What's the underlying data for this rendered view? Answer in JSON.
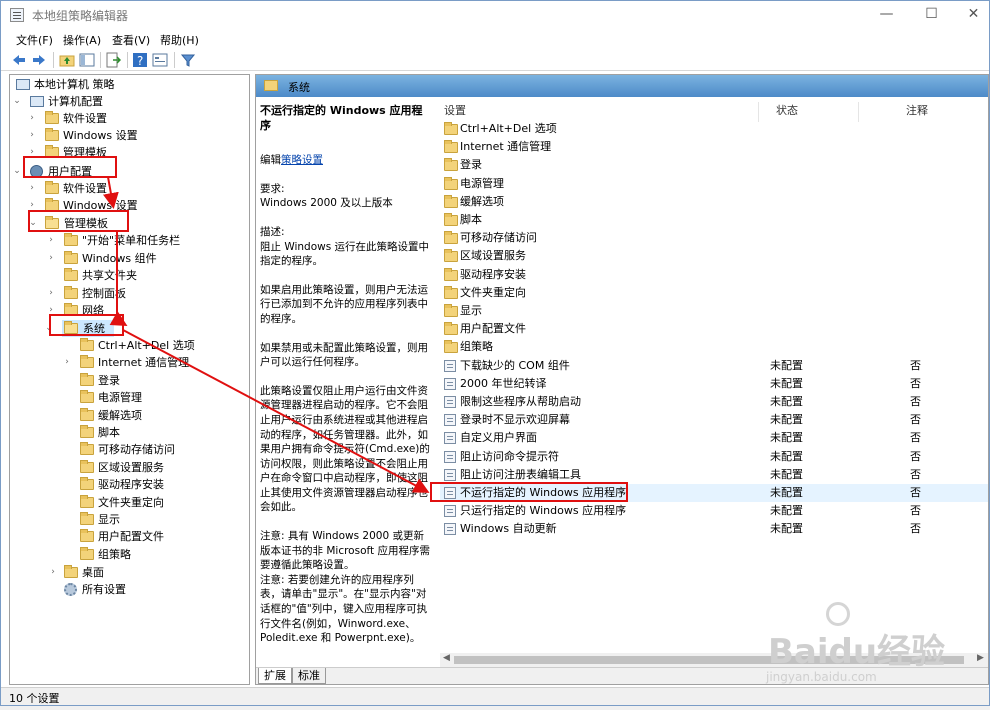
{
  "window": {
    "title": "本地组策略编辑器",
    "controls": {
      "minimize": "—",
      "maximize": "☐",
      "close": "✕"
    }
  },
  "menu": [
    "文件(F)",
    "操作(A)",
    "查看(V)",
    "帮助(H)"
  ],
  "toolbar": {
    "icons": [
      "back-arrow-icon",
      "forward-arrow-icon",
      "up-folder-icon",
      "show-hide-tree-icon",
      "export-list-icon",
      "help-icon",
      "properties-icon",
      "filter-icon"
    ]
  },
  "tree": {
    "root": "本地计算机 策略",
    "computer_config": "计算机配置",
    "cc_children": [
      "软件设置",
      "Windows 设置",
      "管理模板"
    ],
    "user_config": "用户配置",
    "uc_children": [
      "软件设置",
      "Windows 设置"
    ],
    "admin_templates": "管理模板",
    "at_children": [
      "\"开始\"菜单和任务栏",
      "Windows 组件",
      "共享文件夹",
      "控制面板",
      "网络"
    ],
    "system": "系统",
    "system_children": [
      "Ctrl+Alt+Del 选项",
      "Internet 通信管理",
      "登录",
      "电源管理",
      "缓解选项",
      "脚本",
      "可移动存储访问",
      "区域设置服务",
      "驱动程序安装",
      "文件夹重定向",
      "显示",
      "用户配置文件",
      "组策略"
    ],
    "desktop": "桌面",
    "all_settings": "所有设置"
  },
  "right": {
    "header": "系统",
    "description": {
      "title": "不运行指定的 Windows 应用程序",
      "edit_prefix": "编辑",
      "edit_link": "策略设置",
      "req_label": "要求:",
      "req_value": "Windows 2000 及以上版本",
      "desc_label": "描述:",
      "desc_text": "阻止 Windows 运行在此策略设置中指定的程序。",
      "enabled_text": "如果启用此策略设置，则用户无法运行已添加到不允许的应用程序列表中的程序。",
      "disabled_text": "如果禁用或未配置此策略设置，则用户可以运行任何程序。",
      "detail_text": "此策略设置仅阻止用户运行由文件资源管理器进程启动的程序。它不会阻止用户运行由系统进程或其他进程启动的程序，如任务管理器。此外，如果用户拥有命令提示符(Cmd.exe)的访问权限，则此策略设置不会阻止用户在命令窗口中启动程序，即使这阻止其使用文件资源管理器启动程序也会如此。",
      "note1": "注意: 具有 Windows 2000 或更新版本证书的非 Microsoft 应用程序需要遵循此策略设置。",
      "note2": "注意: 若要创建允许的应用程序列表，请单击\"显示\"。在\"显示内容\"对话框的\"值\"列中，键入应用程序可执行文件名(例如，Winword.exe、Poledit.exe 和 Powerpnt.exe)。"
    },
    "columns": {
      "setting": "设置",
      "state": "状态",
      "note": "注释"
    },
    "folders": [
      "Ctrl+Alt+Del 选项",
      "Internet 通信管理",
      "登录",
      "电源管理",
      "缓解选项",
      "脚本",
      "可移动存储访问",
      "区域设置服务",
      "驱动程序安装",
      "文件夹重定向",
      "显示",
      "用户配置文件",
      "组策略"
    ],
    "policies": [
      {
        "name": "下载缺少的 COM 组件",
        "state": "未配置",
        "note": "否"
      },
      {
        "name": "2000 年世纪转译",
        "state": "未配置",
        "note": "否"
      },
      {
        "name": "限制这些程序从帮助启动",
        "state": "未配置",
        "note": "否"
      },
      {
        "name": "登录时不显示欢迎屏幕",
        "state": "未配置",
        "note": "否"
      },
      {
        "name": "自定义用户界面",
        "state": "未配置",
        "note": "否"
      },
      {
        "name": "阻止访问命令提示符",
        "state": "未配置",
        "note": "否"
      },
      {
        "name": "阻止访问注册表编辑工具",
        "state": "未配置",
        "note": "否"
      },
      {
        "name": "不运行指定的 Windows 应用程序",
        "state": "未配置",
        "note": "否"
      },
      {
        "name": "只运行指定的 Windows 应用程序",
        "state": "未配置",
        "note": "否"
      },
      {
        "name": "Windows 自动更新",
        "state": "未配置",
        "note": "否"
      }
    ],
    "tabs": [
      "扩展",
      "标准"
    ]
  },
  "status": "10 个设置",
  "watermark": {
    "brand": "Baidu经验",
    "url": "jingyan.baidu.com"
  },
  "colors": {
    "annotation": "#e01010",
    "header_blue": "#4d8ac8",
    "selection": "#cce8ff"
  }
}
